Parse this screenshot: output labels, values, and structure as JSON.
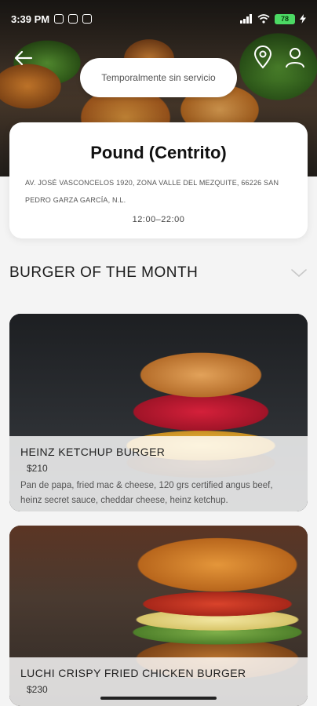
{
  "status_bar": {
    "time": "3:39 PM",
    "battery": "78"
  },
  "header": {
    "service_status": "Temporalmente sin servicio"
  },
  "store": {
    "name": "Pound (Centrito)",
    "address": "AV. JOSÉ VASCONCELOS 1920, ZONA VALLE DEL MEZQUITE, 66226 SAN PEDRO GARZA GARCÍA, N.L.",
    "hours": "12:00–22:00"
  },
  "section": {
    "title": "BURGER OF THE MONTH"
  },
  "products": [
    {
      "name": "HEINZ KETCHUP BURGER",
      "price": "$210",
      "description": "Pan de papa, fried mac & cheese, 120 grs certified angus beef, heinz secret sauce, cheddar cheese, heinz ketchup."
    },
    {
      "name": "LUCHI CRISPY FRIED CHICKEN BURGER",
      "price": "$230"
    }
  ],
  "icons": {
    "back": "arrow-left-icon",
    "location": "map-pin-icon",
    "profile": "user-icon",
    "expand": "chevron-down-icon"
  }
}
